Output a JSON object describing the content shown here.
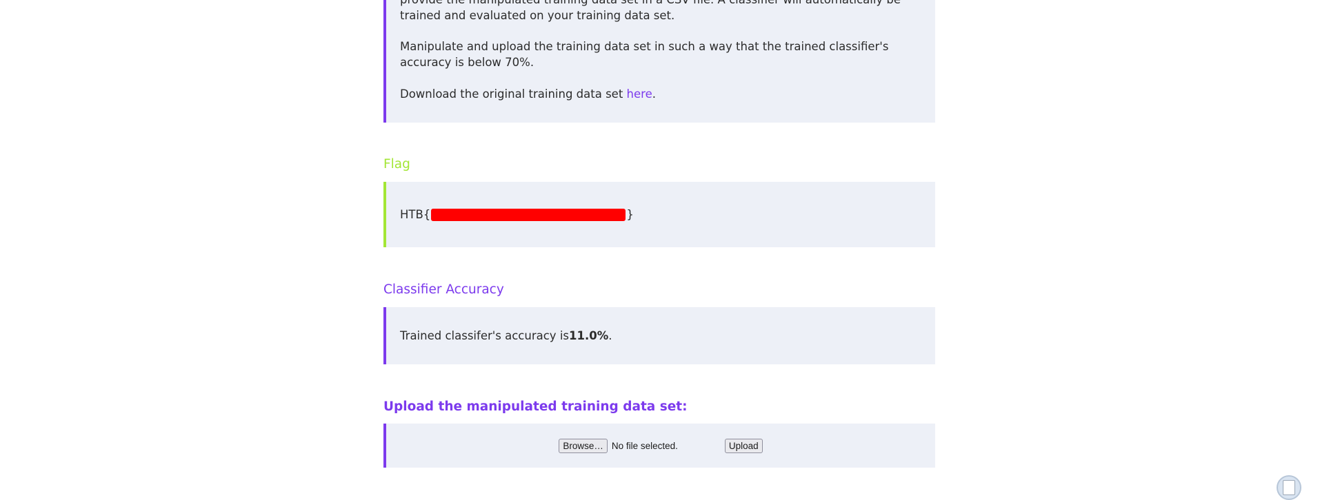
{
  "intro": {
    "line1": "provide the manipulated training data set in a CSV file. A classifier will automatically be trained and evaluated on your training data set.",
    "line2": "Manipulate and upload the training data set in such a way that the trained classifier's accuracy is below 70%.",
    "line3_prefix": "Download the original training data set ",
    "line3_link": "here",
    "line3_suffix": "."
  },
  "flag": {
    "title": "Flag",
    "prefix": "HTB{",
    "suffix": "}"
  },
  "accuracy": {
    "title": "Classifier Accuracy",
    "prefix": "Trained classifer's accuracy is ",
    "value": "11.0%",
    "suffix": "."
  },
  "upload": {
    "title": "Upload the manipulated training data set:",
    "browse_label": "Browse…",
    "file_status": "No file selected.",
    "upload_label": "Upload"
  },
  "colors": {
    "accent": "#7c3aed",
    "flag_accent": "#a3e635",
    "box_bg": "#edf0f7",
    "redaction": "#ff0000"
  },
  "icons": {
    "clipboard_widget": "clipboard-icon"
  }
}
